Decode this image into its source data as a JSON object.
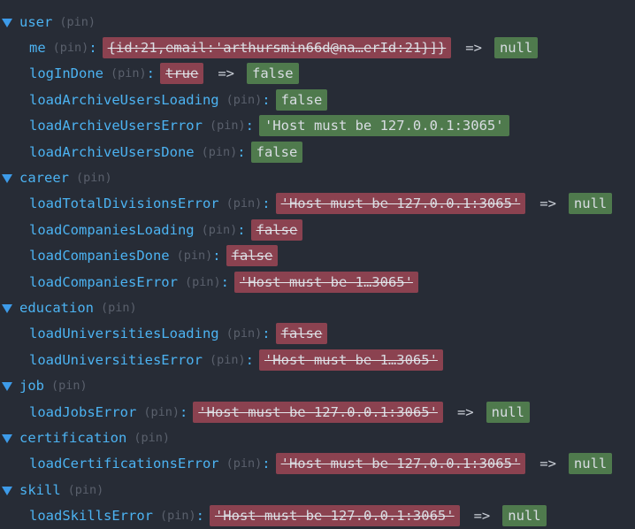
{
  "pin_label": "(pin)",
  "arrow": "=>",
  "sections": [
    {
      "name": "user",
      "props": [
        {
          "key": "me",
          "old": "{id:21,email:'arthursmin66d@na…erId:21}]}",
          "new": "null"
        },
        {
          "key": "logInDone",
          "old": "true",
          "new": "false"
        },
        {
          "key": "loadArchiveUsersLoading",
          "new": "false"
        },
        {
          "key": "loadArchiveUsersError",
          "new": "'Host must be 127.0.0.1:3065'"
        },
        {
          "key": "loadArchiveUsersDone",
          "new": "false"
        }
      ]
    },
    {
      "name": "career",
      "props": [
        {
          "key": "loadTotalDivisionsError",
          "old": "'Host must be 127.0.0.1:3065'",
          "new": "null"
        },
        {
          "key": "loadCompaniesLoading",
          "old": "false"
        },
        {
          "key": "loadCompaniesDone",
          "old": "false"
        },
        {
          "key": "loadCompaniesError",
          "old": "'Host must be 1…3065'"
        }
      ]
    },
    {
      "name": "education",
      "props": [
        {
          "key": "loadUniversitiesLoading",
          "old": "false"
        },
        {
          "key": "loadUniversitiesError",
          "old": "'Host must be 1…3065'"
        }
      ]
    },
    {
      "name": "job",
      "props": [
        {
          "key": "loadJobsError",
          "old": "'Host must be 127.0.0.1:3065'",
          "new": "null"
        }
      ]
    },
    {
      "name": "certification",
      "props": [
        {
          "key": "loadCertificationsError",
          "old": "'Host must be 127.0.0.1:3065'",
          "new": "null"
        }
      ]
    },
    {
      "name": "skill",
      "props": [
        {
          "key": "loadSkillsError",
          "old": "'Host must be 127.0.0.1:3065'",
          "new": "null"
        }
      ]
    }
  ]
}
